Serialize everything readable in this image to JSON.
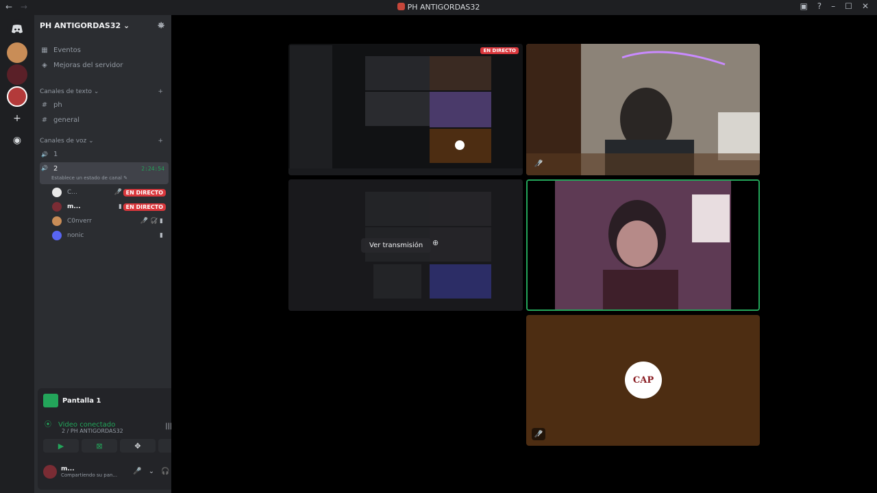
{
  "window": {
    "title": "PH ANTIGORDAS32",
    "nav_back": "←",
    "nav_forward": "→",
    "buttons": [
      "▣",
      "?",
      "–",
      "☐",
      "✕"
    ]
  },
  "server": {
    "name": "PH ANTIGORDAS32 ⌄",
    "add_member_icon": "⛯",
    "nav_items": [
      {
        "icon": "▦",
        "label": "Eventos"
      },
      {
        "icon": "◈",
        "label": "Mejoras del servidor"
      }
    ],
    "text_category": "Canales de texto ⌄",
    "text_channels": [
      {
        "icon": "#",
        "label": "ph"
      },
      {
        "icon": "#",
        "label": "general"
      }
    ],
    "voice_category": "Canales de voz ⌄",
    "voice_channels": [
      {
        "icon": "🔊",
        "label": "1"
      },
      {
        "icon": "🔊",
        "label": "2",
        "timer": "2:24:54",
        "status": "Establece un estado de canal ✎"
      }
    ],
    "voice_users": [
      {
        "name": "C...",
        "badge": "EN DIRECTO",
        "icons": "🎤̸"
      },
      {
        "name": "m...",
        "badge": "EN DIRECTO",
        "icons": "▮"
      },
      {
        "name": "C0nverr",
        "badge": "",
        "icons": "🎤̸ 🎧̸ ▮"
      },
      {
        "name": "nonic",
        "badge": "",
        "icons": "▮"
      }
    ]
  },
  "panel": {
    "stream_title": "Pantalla 1",
    "close_icon": "⊠",
    "voice_status": "Video conectado",
    "voice_location": "2 / PH ANTIGORDAS32",
    "signal_icon": "⦿",
    "wave_icon": "|||",
    "hangup_icon": "☎",
    "buttons": [
      "▶",
      "⊠",
      "✥",
      "✋"
    ],
    "username": "m...",
    "user_status": "Compartiendo su pan...",
    "user_icons": [
      "🎤",
      "⌄",
      "🎧",
      "⌄",
      "⚙"
    ]
  },
  "stage": {
    "live_label": "EN DIRECTO",
    "watch_label": "Ver transmisión",
    "watch_icon": "⊕",
    "mute_icon": "🎤̸",
    "cap_logo_text": "CAP"
  },
  "colors": {
    "accent_green": "#23a55a",
    "live_red": "#da373c",
    "tile_brown": "#4d2d12"
  }
}
